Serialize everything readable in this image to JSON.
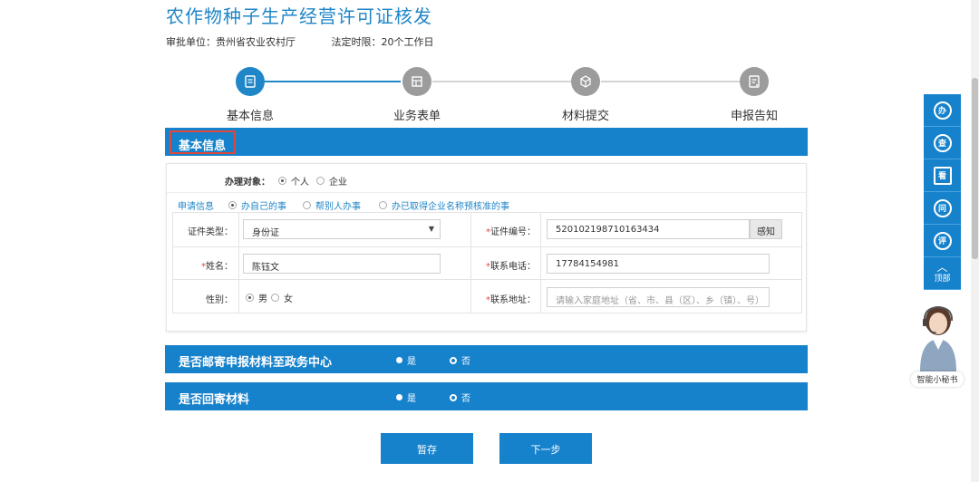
{
  "page": {
    "title": "农作物种子生产经营许可证核发",
    "approval_unit": "审批单位：贵州省农业农村厅",
    "time_limit": "法定时限：20个工作日"
  },
  "steps": [
    {
      "label": "基本信息",
      "active": true,
      "icon": "document-icon"
    },
    {
      "label": "业务表单",
      "active": false,
      "icon": "form-icon"
    },
    {
      "label": "材料提交",
      "active": false,
      "icon": "box-icon"
    },
    {
      "label": "申报告知",
      "active": false,
      "icon": "notice-icon"
    }
  ],
  "basic_section": {
    "title": "基本信息",
    "handle_object": {
      "label": "办理对象：",
      "options": [
        "个人",
        "企业"
      ],
      "selected": "个人"
    },
    "apply_info": {
      "label": "申请信息",
      "options": [
        "办自己的事",
        "帮别人办事",
        "办已取得企业名称预核准的事"
      ],
      "selected": "办自己的事"
    },
    "fields": {
      "id_type_label": "证件类型：",
      "id_type_value": "身份证",
      "id_no_label": "证件编号：",
      "id_no_value": "520102198710163434",
      "sense_button": "感知",
      "name_label": "姓名：",
      "name_value": "陈钰文",
      "phone_label": "联系电话：",
      "phone_value": "17784154981",
      "gender_label": "性别：",
      "gender_options": [
        "男",
        "女"
      ],
      "gender_selected": "男",
      "address_label": "联系地址：",
      "address_placeholder": "请输入家庭地址（省、市、县（区）、乡（镇）、号）"
    }
  },
  "mail_section": {
    "question": "是否邮寄申报材料至政务中心",
    "yes": "是",
    "no": "否",
    "selected": "否"
  },
  "return_section": {
    "question": "是否回寄材料",
    "yes": "是",
    "no": "否",
    "selected": "否"
  },
  "buttons": {
    "save": "暂存",
    "next": "下一步"
  },
  "toolbar": {
    "items": [
      "办",
      "查",
      "看",
      "问",
      "评"
    ],
    "top_label": "顶部"
  },
  "assistant": {
    "label": "智能小秘书"
  },
  "colors": {
    "primary": "#1782cc",
    "title": "#1f86c8",
    "inactive_step": "#9c9c9c",
    "required": "#e0463a"
  }
}
